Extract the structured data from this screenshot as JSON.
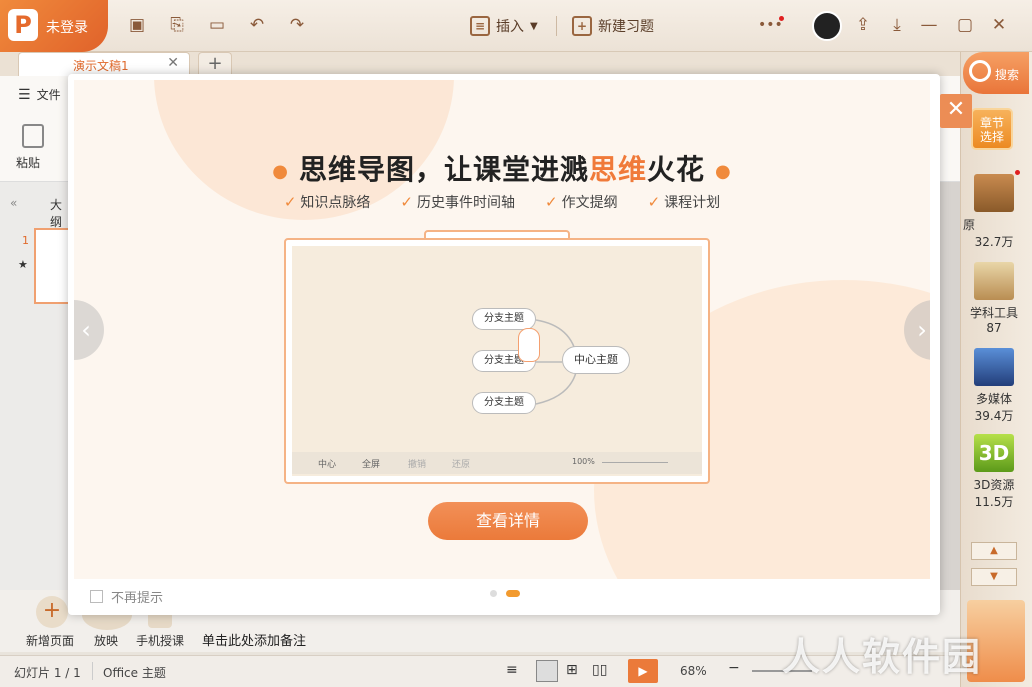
{
  "titlebar": {
    "user_label": "未登录",
    "insert_label": "插入",
    "new_exercise_label": "新建习题"
  },
  "tabs": {
    "doc_name": "演示文稿1"
  },
  "ribbon": {
    "file_label": "文件",
    "paste_label": "粘贴",
    "outline_label": "大纲",
    "slide_number": "1"
  },
  "bottom": {
    "new_page": "新增页面",
    "play": "放映",
    "mobile_teach": "手机授课",
    "note_hint": "单击此处添加备注"
  },
  "status": {
    "slide_info": "幻灯片 1 / 1",
    "theme": "Office 主题",
    "zoom": "68%"
  },
  "rightpanel": {
    "search": "搜索",
    "chapter_select": "章节\n选择",
    "items": [
      {
        "label": "原",
        "count": "32.7万"
      },
      {
        "label": "学科工具",
        "count": "87"
      },
      {
        "label": "多媒体",
        "count": "39.4万"
      },
      {
        "label": "3D资源",
        "count": "11.5万"
      }
    ]
  },
  "modal": {
    "headline_a": "思维导图，让课堂进溅",
    "headline_b": "思维",
    "headline_c": "火花",
    "features": [
      "知识点脉络",
      "历史事件时间轴",
      "作文提纲",
      "课程计划"
    ],
    "preview": {
      "center_node": "中心主题",
      "branch_nodes": [
        "分支主题",
        "分支主题",
        "分支主题"
      ],
      "tools": [
        "中心",
        "全屏",
        "撤销",
        "还原"
      ],
      "zoom": "100%"
    },
    "detail_button": "查看详情",
    "no_remind": "不再提示"
  },
  "watermark": "人人软件园",
  "colors": {
    "accent": "#eb7a3a",
    "brand": "#e0622a"
  }
}
